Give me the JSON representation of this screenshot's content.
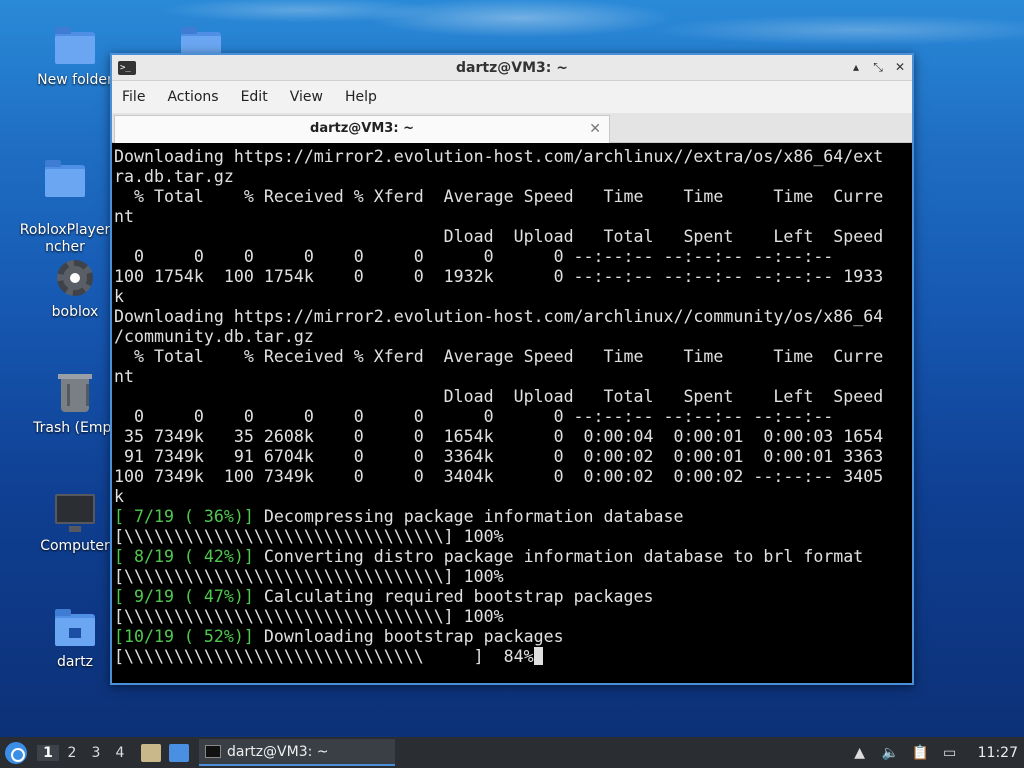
{
  "desktop": {
    "icons": [
      {
        "label": "New folder"
      },
      {
        "label": ""
      },
      {
        "label": "RobloxPlayer\nncher"
      },
      {
        "label": "boblox"
      },
      {
        "label": "Trash (Empt"
      },
      {
        "label": "Computer"
      },
      {
        "label": "dartz"
      }
    ]
  },
  "window": {
    "title": "dartz@VM3: ~",
    "app_icon": ">_",
    "controls": {
      "minimize": "▴",
      "restore": "⤡",
      "close": "✕"
    },
    "menu": [
      "File",
      "Actions",
      "Edit",
      "View",
      "Help"
    ],
    "tab": {
      "label": "dartz@VM3: ~",
      "close": "✕"
    },
    "terminal_lines": [
      "Downloading https://mirror2.evolution-host.com/archlinux//extra/os/x86_64/ext",
      "ra.db.tar.gz",
      "  % Total    % Received % Xferd  Average Speed   Time    Time     Time  Curre",
      "nt",
      "                                 Dload  Upload   Total   Spent    Left  Speed",
      "  0     0    0     0    0     0      0      0 --:--:-- --:--:-- --:--:--",
      "100 1754k  100 1754k    0     0  1932k      0 --:--:-- --:--:-- --:--:-- 1933",
      "k",
      "Downloading https://mirror2.evolution-host.com/archlinux//community/os/x86_64",
      "/community.db.tar.gz",
      "  % Total    % Received % Xferd  Average Speed   Time    Time     Time  Curre",
      "nt",
      "                                 Dload  Upload   Total   Spent    Left  Speed",
      "  0     0    0     0    0     0      0      0 --:--:-- --:--:-- --:--:--",
      " 35 7349k   35 2608k    0     0  1654k      0  0:00:04  0:00:01  0:00:03 1654",
      " 91 7349k   91 6704k    0     0  3364k      0  0:00:02  0:00:01  0:00:01 3363",
      "100 7349k  100 7349k    0     0  3404k      0  0:00:02  0:00:02 --:--:-- 3405",
      "k"
    ],
    "progress_lines": [
      {
        "step": "[ 7/19 ( 36%)]",
        "text": " Decompressing package information database"
      },
      {
        "bar": "[\\\\\\\\\\\\\\\\\\\\\\\\\\\\\\\\\\\\\\\\\\\\\\\\\\\\\\\\\\\\\\\\] 100%"
      },
      {
        "step": "[ 8/19 ( 42%)]",
        "text": " Converting distro package information database to brl format"
      },
      {
        "bar": "[\\\\\\\\\\\\\\\\\\\\\\\\\\\\\\\\\\\\\\\\\\\\\\\\\\\\\\\\\\\\\\\\] 100%"
      },
      {
        "step": "[ 9/19 ( 47%)]",
        "text": " Calculating required bootstrap packages"
      },
      {
        "bar": "[\\\\\\\\\\\\\\\\\\\\\\\\\\\\\\\\\\\\\\\\\\\\\\\\\\\\\\\\\\\\\\\\] 100%"
      },
      {
        "step": "[10/19 ( 52%)]",
        "text": " Downloading bootstrap packages"
      },
      {
        "bar": "[\\\\\\\\\\\\\\\\\\\\\\\\\\\\\\\\\\\\\\\\\\\\\\\\\\\\\\\\\\\\     ]  84%"
      }
    ]
  },
  "taskbar": {
    "workspaces": [
      "1",
      "2",
      "3",
      "4"
    ],
    "task_label": "dartz@VM3: ~",
    "tray": {
      "sort_icon": "▲",
      "volume_icon": "🔈",
      "clipboard_icon": "📋",
      "network_icon": "▭"
    },
    "clock": "11:27"
  }
}
